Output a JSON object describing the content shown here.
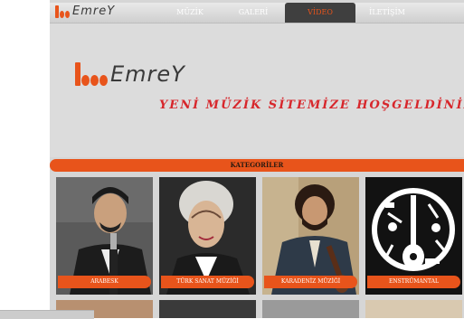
{
  "brand": {
    "name": "EmreY",
    "accent": "#e8541b"
  },
  "nav": {
    "items": [
      {
        "label": "MÜZİK"
      },
      {
        "label": "GALERİ"
      },
      {
        "label": "VİDEO",
        "active": true
      },
      {
        "label": "İLETİŞİM"
      }
    ]
  },
  "hero": {
    "welcome": "YENİ MÜZİK SİTEMİZE HOŞGELDİNİZ"
  },
  "categories": {
    "title": "KATEGORİLER",
    "items": [
      {
        "label": "ARABESK"
      },
      {
        "label": "TÜRK SANAT MÜZİĞİ"
      },
      {
        "label": "KARADENİZ MÜZİĞİ"
      },
      {
        "label": "ENSTRÜMANTAL"
      }
    ]
  }
}
